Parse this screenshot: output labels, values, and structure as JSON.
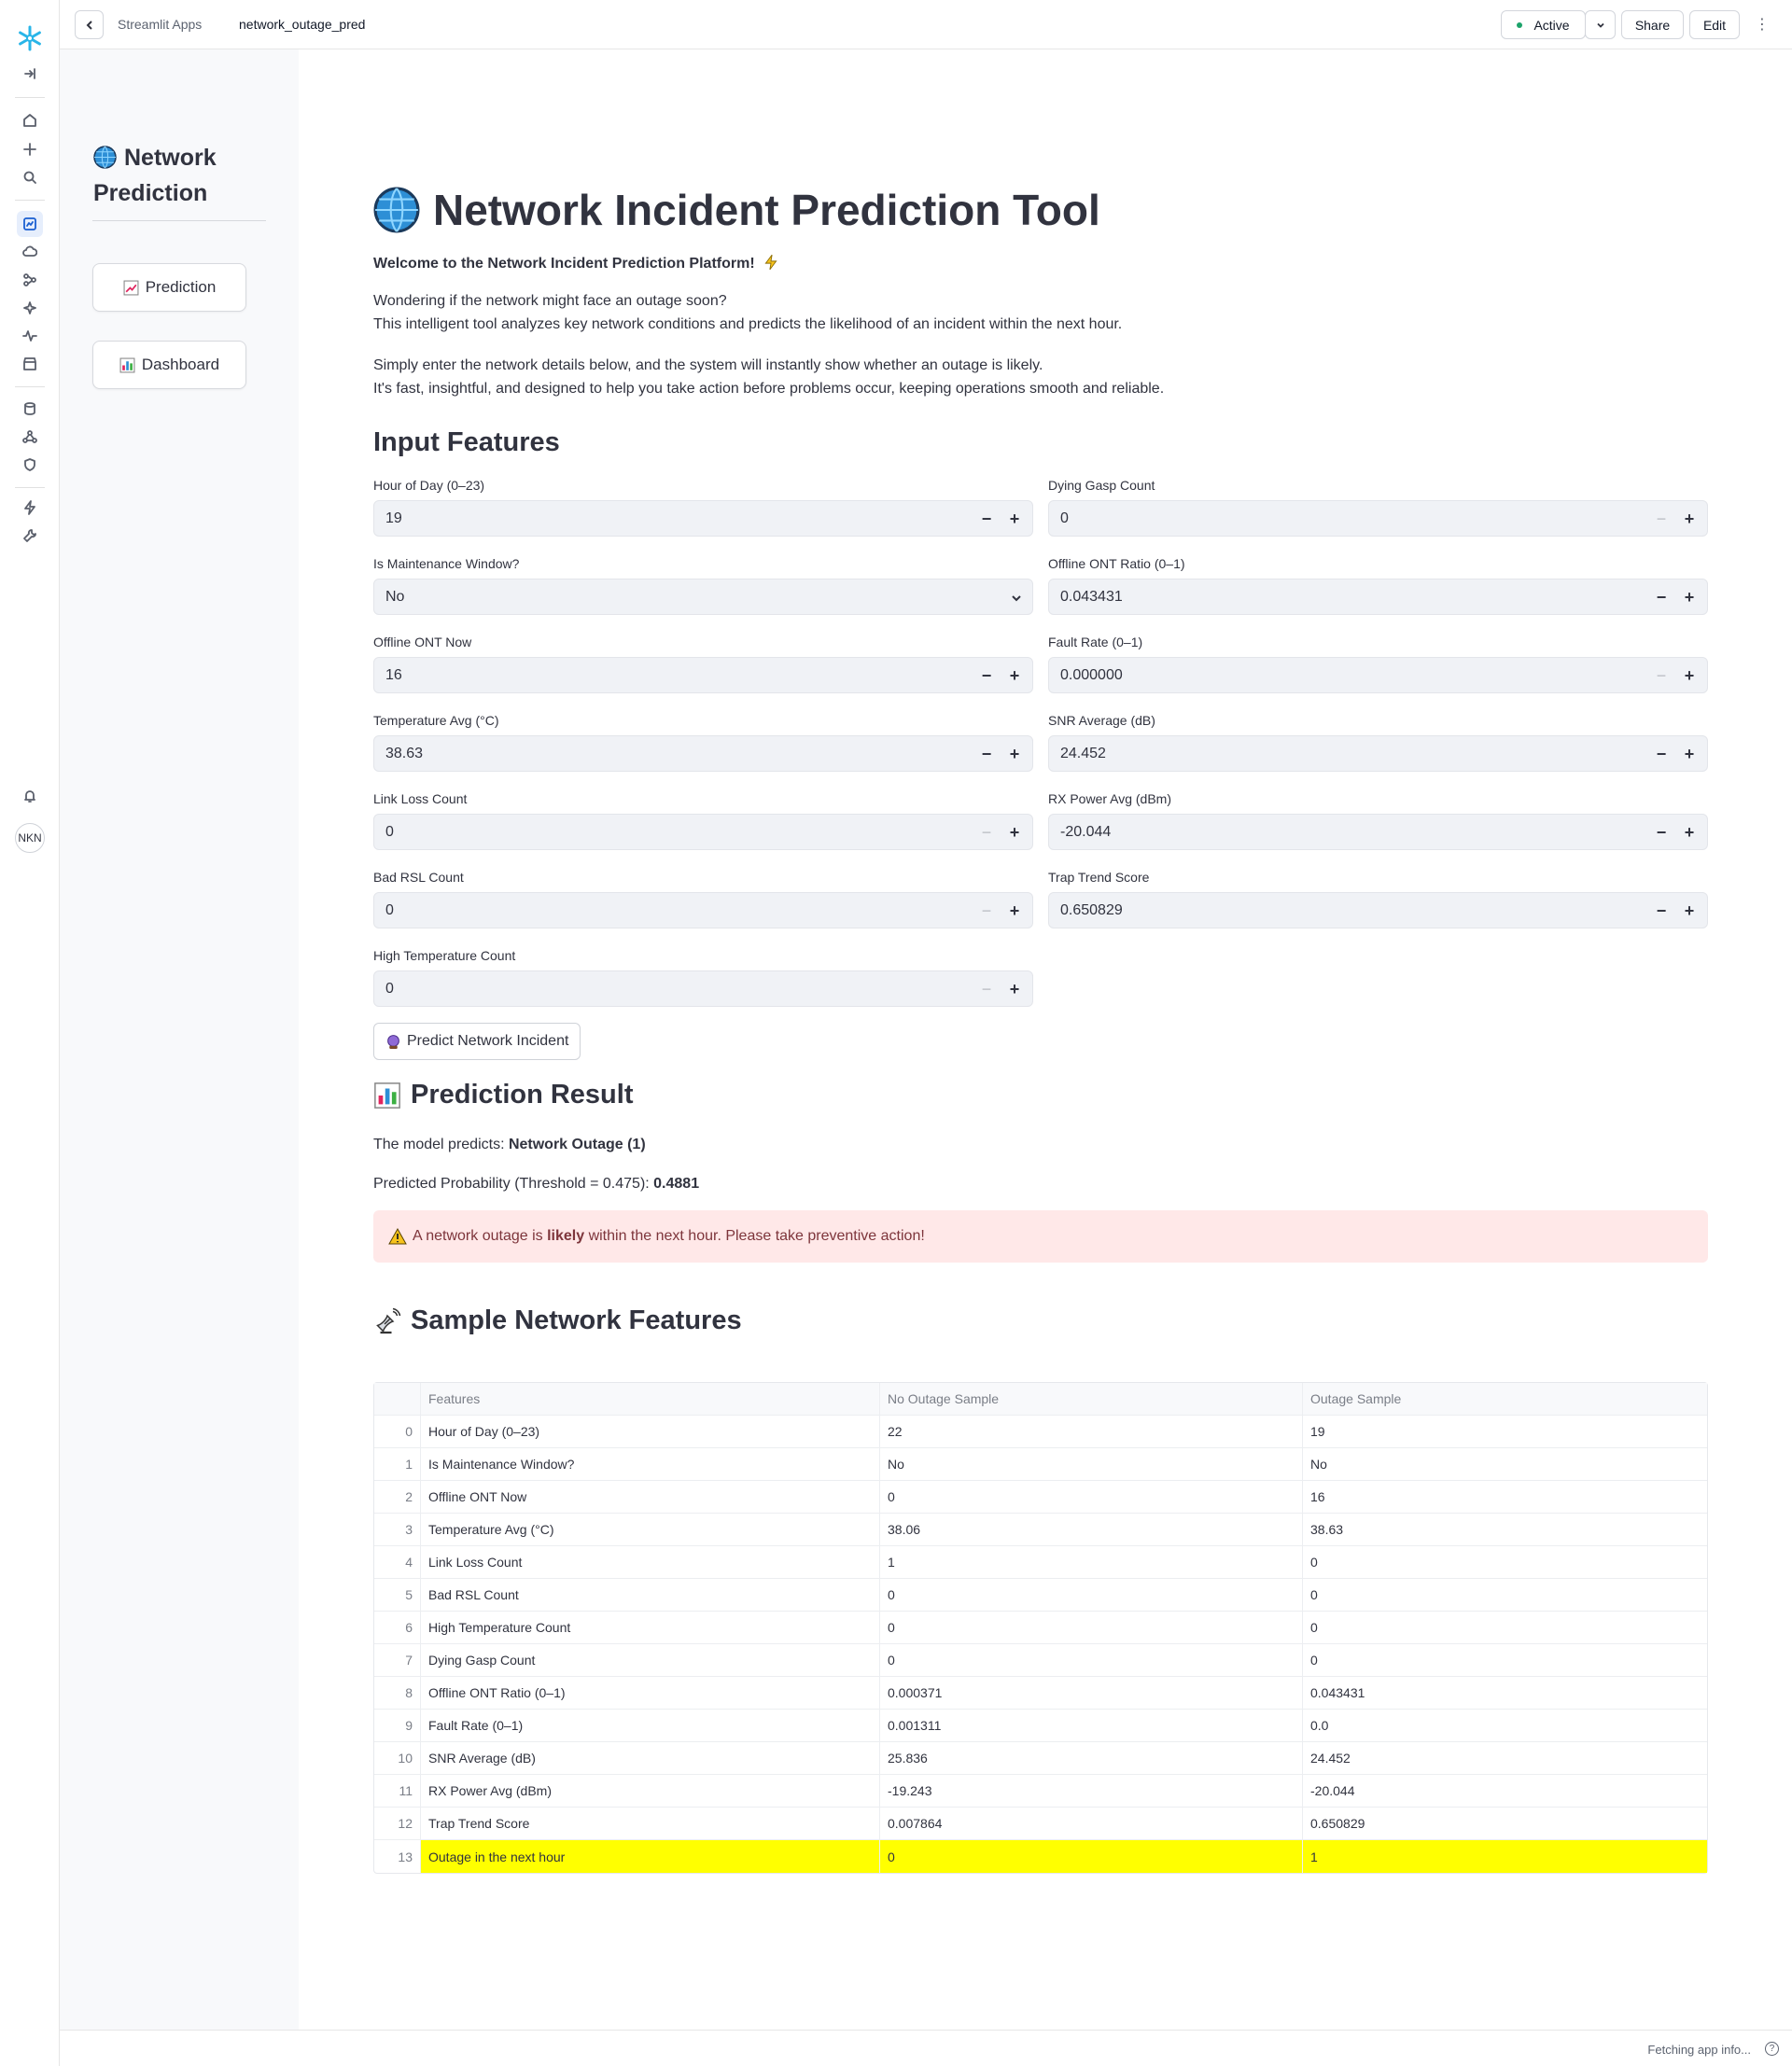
{
  "topbar": {
    "breadcrumb_parent": "Streamlit Apps",
    "app_name": "network_outage_pred",
    "status_label": "Active",
    "share_label": "Share",
    "edit_label": "Edit"
  },
  "user": {
    "initials": "NKN"
  },
  "sidebar": {
    "title": "Network Prediction",
    "nav": [
      {
        "label": "Prediction",
        "icon": "chart-increasing-icon"
      },
      {
        "label": "Dashboard",
        "icon": "bar-chart-icon"
      }
    ]
  },
  "main": {
    "title": "Network Incident Prediction Tool",
    "welcome": "Welcome to the Network Incident Prediction Platform!",
    "intro_line1": "Wondering if the network might face an outage soon?",
    "intro_line2": "This intelligent tool analyzes key network conditions and predicts the likelihood of an incident within the next hour.",
    "intro_line3": "Simply enter the network details below, and the system will instantly show whether an outage is likely.",
    "intro_line4": "It's fast, insightful, and designed to help you take action before problems occur, keeping operations smooth and reliable.",
    "input_heading": "Input Features",
    "fields": {
      "hour": {
        "label": "Hour of Day (0–23)",
        "value": "19"
      },
      "maintenance": {
        "label": "Is Maintenance Window?",
        "value": "No"
      },
      "offline_now": {
        "label": "Offline ONT Now",
        "value": "16"
      },
      "temp_avg": {
        "label": "Temperature Avg (°C)",
        "value": "38.63"
      },
      "link_loss": {
        "label": "Link Loss Count",
        "value": "0"
      },
      "bad_rsl": {
        "label": "Bad RSL Count",
        "value": "0"
      },
      "high_temp": {
        "label": "High Temperature Count",
        "value": "0"
      },
      "dying_gasp": {
        "label": "Dying Gasp Count",
        "value": "0"
      },
      "offline_ratio": {
        "label": "Offline ONT Ratio (0–1)",
        "value": "0.043431"
      },
      "fault_rate": {
        "label": "Fault Rate (0–1)",
        "value": "0.000000"
      },
      "snr": {
        "label": "SNR Average (dB)",
        "value": "24.452"
      },
      "rx_power": {
        "label": "RX Power Avg (dBm)",
        "value": "-20.044"
      },
      "trap_trend": {
        "label": "Trap Trend Score",
        "value": "0.650829"
      }
    },
    "predict_button": "Predict Network Incident",
    "result_heading": "Prediction Result",
    "model_predicts_prefix": "The model predicts: ",
    "model_predicts_value": "Network Outage (1)",
    "probability_prefix": "Predicted Probability (Threshold = 0.475): ",
    "probability_value": "0.4881",
    "alert_prefix": "A network outage is ",
    "alert_bold": "likely",
    "alert_suffix": " within the next hour. Please take preventive action!",
    "sample_heading": "Sample Network Features"
  },
  "table": {
    "columns": [
      "Features",
      "No Outage Sample",
      "Outage Sample"
    ],
    "rows": [
      [
        "0",
        "Hour of Day (0–23)",
        "22",
        "19"
      ],
      [
        "1",
        "Is Maintenance Window?",
        "No",
        "No"
      ],
      [
        "2",
        "Offline ONT Now",
        "0",
        "16"
      ],
      [
        "3",
        "Temperature Avg (°C)",
        "38.06",
        "38.63"
      ],
      [
        "4",
        "Link Loss Count",
        "1",
        "0"
      ],
      [
        "5",
        "Bad RSL Count",
        "0",
        "0"
      ],
      [
        "6",
        "High Temperature Count",
        "0",
        "0"
      ],
      [
        "7",
        "Dying Gasp Count",
        "0",
        "0"
      ],
      [
        "8",
        "Offline ONT Ratio (0–1)",
        "0.000371",
        "0.043431"
      ],
      [
        "9",
        "Fault Rate (0–1)",
        "0.001311",
        "0.0"
      ],
      [
        "10",
        "SNR Average (dB)",
        "25.836",
        "24.452"
      ],
      [
        "11",
        "RX Power Avg (dBm)",
        "-19.243",
        "-20.044"
      ],
      [
        "12",
        "Trap Trend Score",
        "0.007864",
        "0.650829"
      ],
      [
        "13",
        "Outage in the next hour",
        "0",
        "1"
      ]
    ],
    "highlight_row_color": "#ffff00"
  },
  "footer": {
    "status": "Fetching app info..."
  },
  "colors": {
    "accent": "#1a5fd1",
    "status_green": "#1ca36b",
    "alert_bg": "#ffe8e8",
    "alert_text": "#7d353b"
  }
}
